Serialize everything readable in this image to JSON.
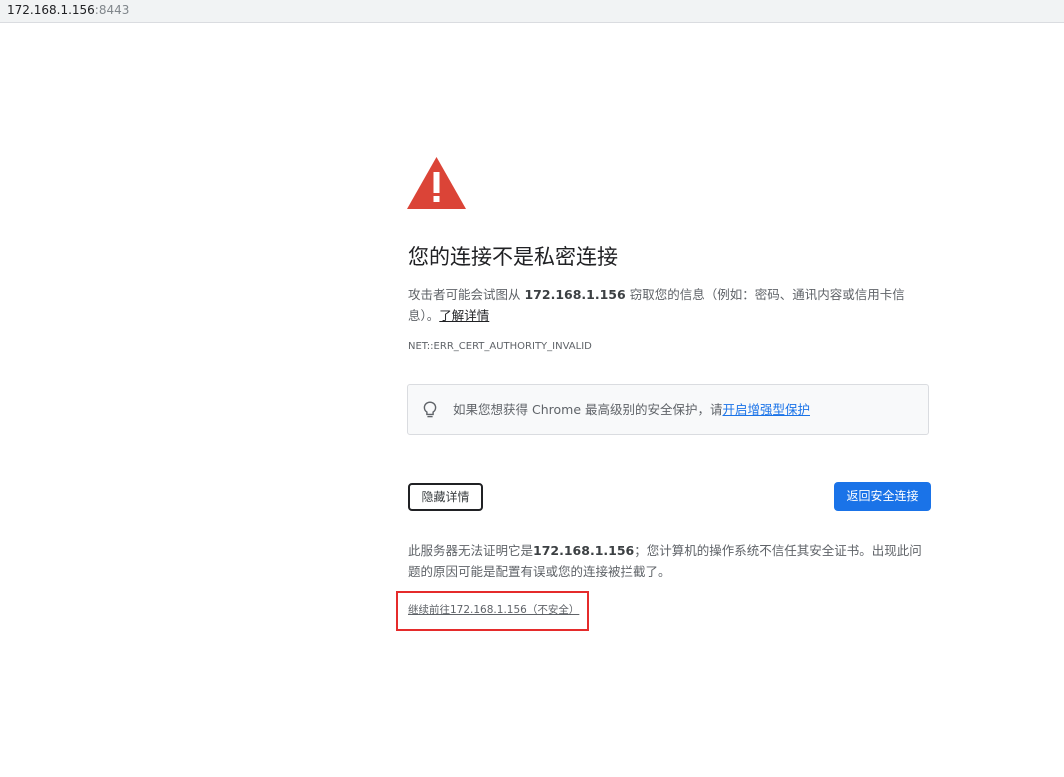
{
  "address_bar": {
    "host": "172.168.1.156",
    "port": ":8443"
  },
  "main": {
    "icon": "warning-triangle-icon",
    "title": "您的连接不是私密连接",
    "description": {
      "before": "攻击者可能会试图从 ",
      "host": "172.168.1.156",
      "after": " 窃取您的信息（例如：密码、通讯内容或信用卡信息）。",
      "learn_more": "了解详情"
    },
    "error_code": "NET::ERR_CERT_AUTHORITY_INVALID",
    "tip": {
      "icon": "lightbulb-icon",
      "text": "如果您想获得 Chrome 最高级别的安全保护，请",
      "link": "开启增强型保护"
    },
    "buttons": {
      "hide_details": "隐藏详情",
      "back_to_safety": "返回安全连接"
    },
    "details": {
      "before": "此服务器无法证明它是",
      "host": "172.168.1.156",
      "after": "；您计算机的操作系统不信任其安全证书。出现此问题的原因可能是配置有误或您的连接被拦截了。"
    },
    "proceed_link": "继续前往172.168.1.156（不安全）"
  },
  "colors": {
    "warning_red": "#db4437",
    "primary_blue": "#1a73e8",
    "highlight_red": "#e52b2b"
  }
}
